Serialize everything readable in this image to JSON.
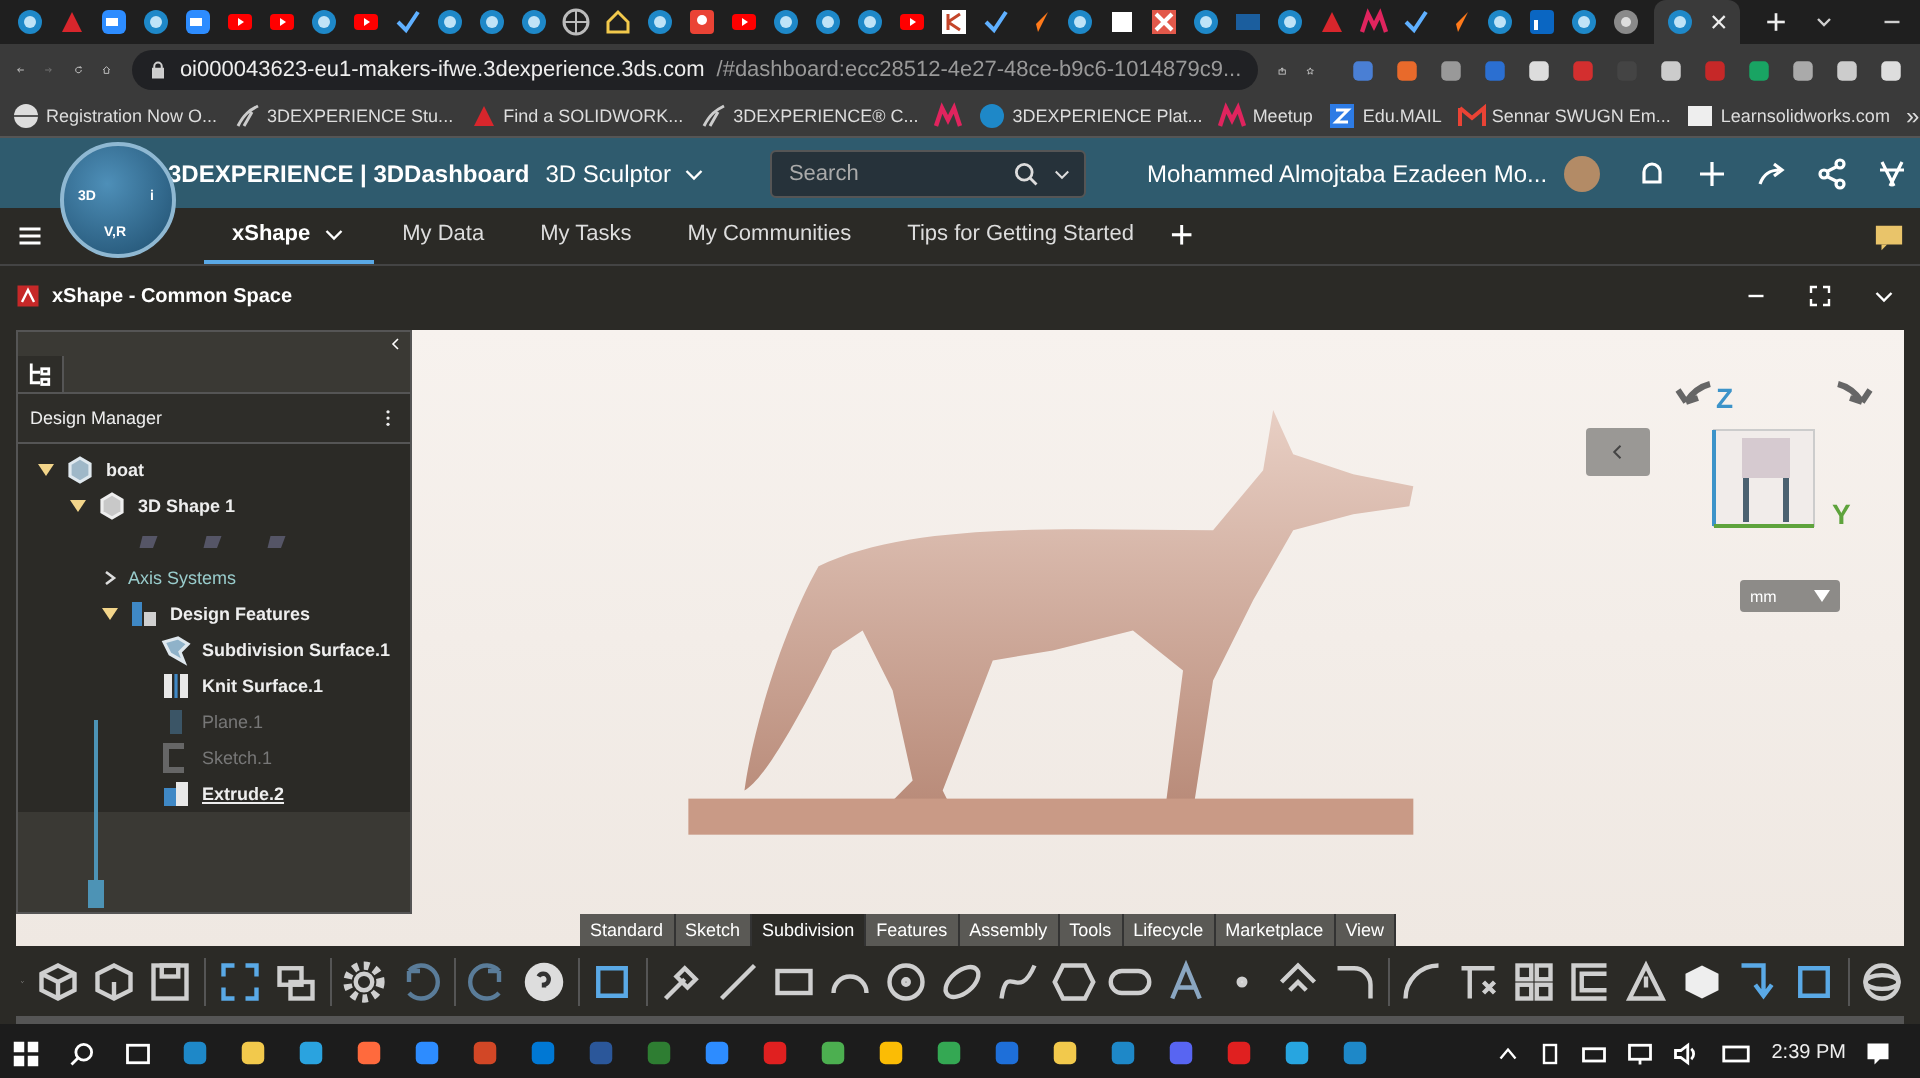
{
  "browser": {
    "close_tab": "×",
    "new_tab": "+",
    "address_host": "oi000043623-eu1-makers-ifwe.3dexperience.3ds.com",
    "address_path": "/#dashboard:ecc28512-4e27-48ce-b9c6-1014879c9...",
    "bookmarks": [
      {
        "kind": "globe",
        "label": "Registration Now O..."
      },
      {
        "kind": "swirl",
        "label": "3DEXPERIENCE Stu..."
      },
      {
        "kind": "sw",
        "label": "Find a SOLIDWORK..."
      },
      {
        "kind": "swirl",
        "label": "3DEXPERIENCE® C..."
      },
      {
        "kind": "m"
      },
      {
        "kind": "sphere",
        "label": "3DEXPERIENCE Plat..."
      },
      {
        "kind": "m",
        "label": "Meetup"
      },
      {
        "kind": "z",
        "label": "Edu.MAIL"
      },
      {
        "kind": "mail",
        "label": "Sennar SWUGN Em..."
      },
      {
        "kind": "lsw",
        "label": "Learnsolidworks.com"
      }
    ],
    "more": "»"
  },
  "header": {
    "brand": "3DEXPERIENCE | 3DDashboard",
    "app": "3D Sculptor",
    "compass_left": "3D",
    "compass_right": "i",
    "compass_bottom": "V,R",
    "search": {
      "placeholder": "Search"
    },
    "user": "Mohammed Almojtaba Ezadeen Mo..."
  },
  "dashboard_tabs": [
    {
      "label": "xShape",
      "selected": true
    },
    {
      "label": "My Data",
      "selected": false
    },
    {
      "label": "My Tasks",
      "selected": false
    },
    {
      "label": "My Communities",
      "selected": false
    },
    {
      "label": "Tips for Getting Started",
      "selected": false
    }
  ],
  "add_tab": "+",
  "panel": {
    "title": "xShape - Common Space"
  },
  "design_manager": {
    "title": "Design Manager",
    "history": {
      "level": 1
    },
    "tree": [
      {
        "kind": "part",
        "label": "boat",
        "expanded": true,
        "children": [
          {
            "kind": "shape",
            "label": "3D Shape 1",
            "expanded": true,
            "children": [
              {
                "kind": "planes"
              },
              {
                "kind": "axis",
                "label": "Axis Systems",
                "expanded": false
              },
              {
                "kind": "features",
                "label": "Design Features",
                "expanded": true,
                "children": [
                  {
                    "kind": "subdivision",
                    "label": "Subdivision Surface.1",
                    "hidden": false,
                    "current": false
                  },
                  {
                    "kind": "knit",
                    "label": "Knit Surface.1",
                    "hidden": false,
                    "current": false
                  },
                  {
                    "kind": "plane",
                    "label": "Plane.1",
                    "hidden": true,
                    "current": false
                  },
                  {
                    "kind": "sketch",
                    "label": "Sketch.1",
                    "hidden": true,
                    "current": false
                  },
                  {
                    "kind": "extrude",
                    "label": "Extrude.2",
                    "hidden": false,
                    "current": true
                  }
                ]
              }
            ]
          }
        ]
      }
    ]
  },
  "compass": {
    "z": "Z",
    "y": "Y"
  },
  "units": "mm",
  "action_tabs": [
    {
      "label": "Standard",
      "selected": false
    },
    {
      "label": "Sketch",
      "selected": false
    },
    {
      "label": "Subdivision",
      "selected": true
    },
    {
      "label": "Features",
      "selected": false
    },
    {
      "label": "Assembly",
      "selected": false
    },
    {
      "label": "Tools",
      "selected": false
    },
    {
      "label": "Lifecycle",
      "selected": false
    },
    {
      "label": "Marketplace",
      "selected": false
    },
    {
      "label": "View",
      "selected": false
    }
  ],
  "taskbar": {
    "time": "2:39 PM"
  }
}
